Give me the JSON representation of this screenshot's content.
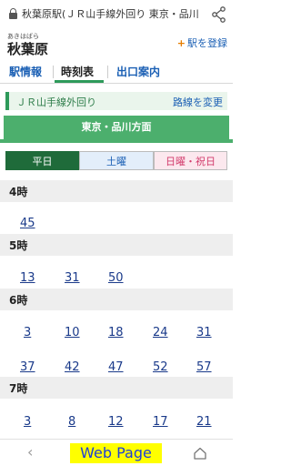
{
  "browser": {
    "url_text": "秋葉原駅(ＪＲ山手線外回り 東京・品川",
    "lock_icon": "lock-icon",
    "share_icon": "share-icon"
  },
  "header": {
    "furigana": "あきはばら",
    "station_name": "秋葉原",
    "register_label": "駅を登録",
    "register_icon": "plus-icon"
  },
  "tabs": [
    {
      "label": "駅情報",
      "active": false
    },
    {
      "label": "時刻表",
      "active": true
    },
    {
      "label": "出口案内",
      "active": false
    }
  ],
  "line": {
    "name": "ＪＲ山手線外回り",
    "change_label": "路線を変更"
  },
  "direction": "東京・品川方面",
  "day_tabs": [
    {
      "label": "平日",
      "selected": true
    },
    {
      "label": "土曜",
      "selected": false
    },
    {
      "label": "日曜・祝日",
      "selected": false
    }
  ],
  "timetable": [
    {
      "hour": "4時",
      "minutes": [
        "45"
      ]
    },
    {
      "hour": "5時",
      "minutes": [
        "13",
        "31",
        "50"
      ]
    },
    {
      "hour": "6時",
      "minutes": [
        "3",
        "10",
        "18",
        "24",
        "31",
        "37",
        "42",
        "47",
        "52",
        "57"
      ]
    },
    {
      "hour": "7時",
      "minutes": [
        "3",
        "8",
        "12",
        "17",
        "21"
      ]
    }
  ],
  "navbar": {
    "back_icon": "back-chevron-icon",
    "label": "Web Page",
    "home_icon": "home-icon"
  },
  "colors": {
    "accent_green": "#4caf6d",
    "link_blue": "#1a5fb4",
    "weekday_tab": "#1f6b3a"
  }
}
